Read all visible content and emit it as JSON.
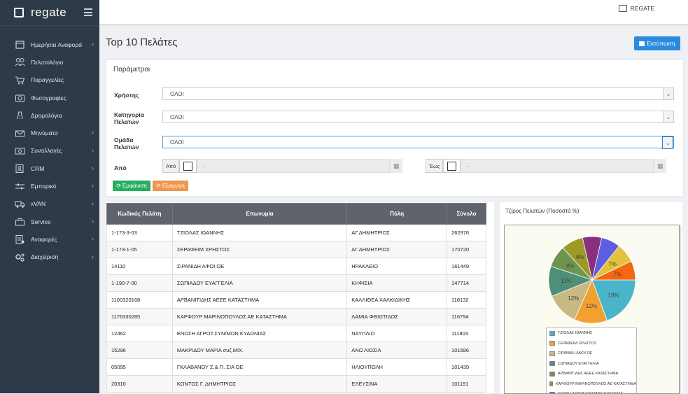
{
  "brand": {
    "name": "regate"
  },
  "topbar": {
    "user": "REGATE"
  },
  "sidebar": {
    "items": [
      {
        "label": "Ημερήσια Αναφορά",
        "chevron": true,
        "icon": "calendar-icon"
      },
      {
        "label": "Πελατολόγιο",
        "chevron": false,
        "icon": "users-icon"
      },
      {
        "label": "Παραγγελίες",
        "chevron": false,
        "icon": "cart-icon"
      },
      {
        "label": "Φωτογραφίες",
        "chevron": false,
        "icon": "camera-icon"
      },
      {
        "label": "Δρομολόγια",
        "chevron": false,
        "icon": "road-icon"
      },
      {
        "label": "Μηνύματα",
        "chevron": true,
        "icon": "envelope-icon"
      },
      {
        "label": "Συναλλαγές",
        "chevron": true,
        "icon": "money-icon"
      },
      {
        "label": "CRM",
        "chevron": true,
        "icon": "contact-icon"
      },
      {
        "label": "Εμπορικό",
        "chevron": true,
        "icon": "sliders-icon"
      },
      {
        "label": "xVAN",
        "chevron": true,
        "icon": "truck-icon"
      },
      {
        "label": "Service",
        "chevron": true,
        "icon": "toolbox-icon"
      },
      {
        "label": "Αναφορές",
        "chevron": true,
        "icon": "reports-icon"
      },
      {
        "label": "Διαχείριση",
        "chevron": true,
        "icon": "gears-icon"
      }
    ]
  },
  "page": {
    "title": "Top 10 Πελάτες",
    "print_label": "Εκτύπωση"
  },
  "params": {
    "title": "Παράμετροι",
    "user_label": "Χρήστης",
    "user_value": "ΟΛΟΙ",
    "category_label": "Κατηγορία Πελατών",
    "category_value": "ΟΛΟΙ",
    "group_label": "Ομάδα Πελατών",
    "group_value": "ΟΛΟΙ",
    "from_label": "Από",
    "from_addon": "Από",
    "from_value": "-",
    "to_addon": "Έως",
    "to_value": "-",
    "show_button": "Εμφάνιση",
    "export_button": "Εξαγωγή"
  },
  "table": {
    "headers": [
      "Κωδικός Πελάτη",
      "Επωνυμία",
      "Πόλη",
      "Σύνολο"
    ],
    "rows": [
      [
        "1-173-3-03",
        "ΤΖΙΟΛΑΣ ΙΩΑΝΝΗΣ",
        "ΑΓ.ΔΗΜΗΤΡΙΟΣ",
        "262976"
      ],
      [
        "1-173-1-05",
        "ΣΕΡΑΦΕΙΜ ΧΡΗΣΤΟΣ",
        "ΑΓ.ΔΗΜΗΤΡΙΟΣ",
        "170720"
      ],
      [
        "14110",
        "ΣΙΡΑΝΙΔΗ ΑΦΟΙ ΟΕ",
        "ΗΡΑΚΛΕΙΟ",
        "161449"
      ],
      [
        "1-190-7-00",
        "ΣΩΠΙΑΔΟΥ ΕΥΑΓΓΕΛΙΑ",
        "ΚΗΦΙΣΙΑ",
        "147714"
      ],
      [
        "1100320168",
        "ΑΡΒΑΝΙΤΙΔΗΣ ΑΕΕΕ ΚΑΤΑΣΤΗΜΑ",
        "ΚΑΛΛΙΘΕΑ ΧΑΛΚΙΔΙΚΗΣ",
        "118132"
      ],
      [
        "1176330285",
        "ΚΑΡΦΟΥΡ ΜΑΡΙΝΟΠΟΥΛΟΣ ΑΕ ΚΑΤΑΣΤΗΜΑ",
        "ΛΑΜΙΑ ΦΘΙΩΤΙΔΟΣ",
        "116794"
      ],
      [
        "12462",
        "ΕΝΩΣΗ ΑΓΡΟΤ.ΣΥΝ/ΜΩΝ ΚΥΔΩΝΙΑΣ",
        "ΝΑΥΠΛΙΟ",
        "111803"
      ],
      [
        "15296",
        "ΜΑΚΡΙΔΟΥ ΜΑΡΙΑ συζ.ΜΙΧ.",
        "ΑΝΩ ΛΙΟΣΙΑ",
        "101686"
      ],
      [
        "05095",
        "ΓΚΛΑΒΑΝΟΥ Σ.& Π. ΣΙΑ ΟΕ",
        "ΗΛΙΟΥΠΟΛΗ",
        "101439"
      ],
      [
        "20310",
        "ΚΟΝΤΟΣ Γ. ΔΗΜΗΤΡΙΟΣ",
        "ΕΛΕΥΣΙΝΑ",
        "101191"
      ]
    ]
  },
  "chart_data": {
    "type": "pie",
    "title": "Τζίρος Πελατών (Ποσοστό %)",
    "slices": [
      {
        "label": "ΤΖΙΟΛΑΣ ΙΩΑΝΝΗΣ",
        "value": 19,
        "text": "19%",
        "color": "#4ab5c8"
      },
      {
        "label": "ΣΕΡΑΦΕΙΜ ΧΡΗΣΤΟΣ",
        "value": 12,
        "text": "12%",
        "color": "#f2a030"
      },
      {
        "label": "ΣΙΡΑΝΙΔΗ ΑΦΟΙ ΟΕ",
        "value": 12,
        "text": "12%",
        "color": "#c8b882"
      },
      {
        "label": "ΣΩΠΙΑΔΟΥ ΕΥΑΓΓΕΛΙΑ",
        "value": 11,
        "text": "11%",
        "color": "#4f8f78"
      },
      {
        "label": "ΑΡΒΑΝΙΤΙΔΗΣ ΑΕΕΕ ΚΑΤΑΣΤΗΜΑ",
        "value": 8,
        "text": "8%",
        "color": "#6d9550"
      },
      {
        "label": "ΚΑΡΦΟΥΡ ΜΑΡΙΝΟΠΟΥΛΟΣ ΑΕ ΚΑΤΑΣΤΗΜΑ",
        "value": 8,
        "text": "8%",
        "color": "#9c9a22"
      },
      {
        "label": "ΕΝΩΣΗ ΑΓΡΟΤ.ΣΥΝ/ΜΩΝ ΚΥΔΩΝΙΑΣ",
        "value": 7,
        "text": "",
        "color": "#8b2f7c"
      },
      {
        "label": "",
        "value": 7,
        "text": "",
        "color": "#5d5fe0"
      },
      {
        "label": "",
        "value": 7,
        "text": "7%",
        "color": "#e3c13c"
      },
      {
        "label": "",
        "value": 7,
        "text": "7%",
        "color": "#f4660f"
      }
    ],
    "legend_labels": [
      "ΤΖΙΟΛΑΣ ΙΩΑΝΝΗΣ",
      "ΣΕΡΑΦΕΙΜ ΧΡΗΣΤΟΣ",
      "ΣΙΡΑΝΙΔΗ ΑΦΟΙ ΟΕ",
      "ΣΩΠΙΑΔΟΥ ΕΥΑΓΓΕΛΙΑ",
      "ΑΡΒΑΝΙΤΙΔΗΣ ΑΕΕΕ ΚΑΤΑΣΤΗΜΑ",
      "ΚΑΡΦΟΥΡ ΜΑΡΙΝΟΠΟΥΛΟΣ ΑΕ ΚΑΤΑΣΤΗΜΑ",
      "ΕΝΩΣΗ ΑΓΡΟΤ.ΣΥΝ/ΜΩΝ ΚΥΔΩΝΙΑΣ"
    ],
    "legend_placement": "bottom"
  }
}
